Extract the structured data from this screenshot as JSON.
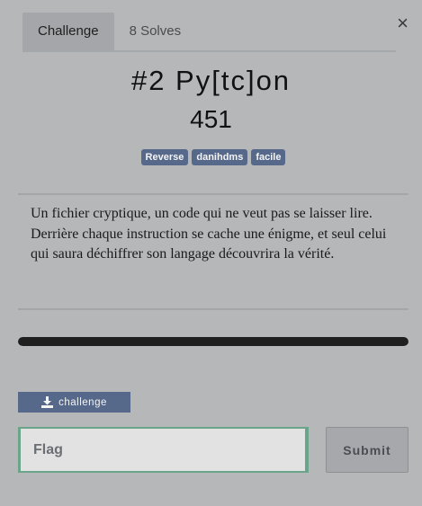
{
  "modal": {
    "close_label": "×",
    "tabs": [
      {
        "label": "Challenge",
        "active": true
      },
      {
        "label": "8 Solves",
        "active": false
      }
    ],
    "title": "#2 Py[tc]on",
    "points": "451",
    "tags": [
      "Reverse",
      "danihdms",
      "facile"
    ],
    "description": "Un fichier cryptique, un code qui ne veut pas se laisser lire. Derrière chaque instruction se cache une énigme, et seul celui qui saura déchiffrer son langage découvrira la vérité.",
    "progress": 1.0,
    "file": {
      "label": "challenge",
      "icon": "download-icon"
    },
    "flag": {
      "placeholder": "Flag",
      "value": ""
    },
    "submit_label": "Submit",
    "colors": {
      "tag": "#56698a",
      "accent": "#6aa58b",
      "backdrop": "#b5b7b9"
    }
  }
}
